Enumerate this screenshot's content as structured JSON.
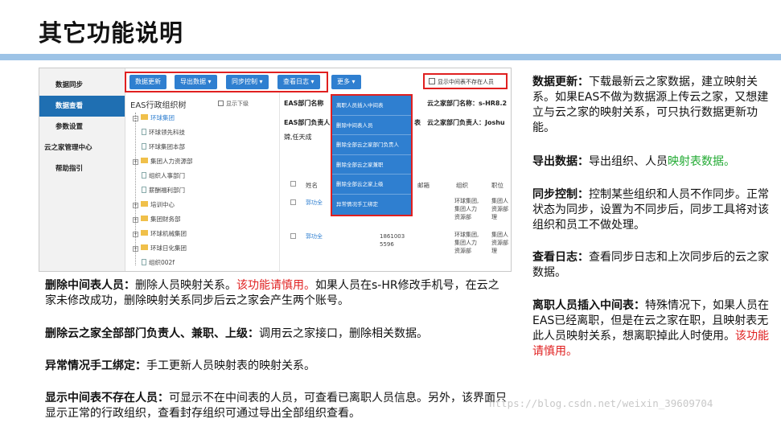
{
  "title": "其它功能说明",
  "screenshot": {
    "sidebar": [
      "数据同步",
      "数据查看",
      "参数设置",
      "云之家管理中心",
      "帮助指引"
    ],
    "toolbar": [
      "数据更新",
      "导出数据 ▾",
      "同步控制 ▾",
      "查看日志 ▾",
      "更多 ▾"
    ],
    "show_missing_checkbox": "显示中间表不存在人员",
    "dropdown": [
      "离职人员插入中间表",
      "删除中间表人员",
      "删除全部云之家部门负责人",
      "删除全部云之家兼职",
      "删除全部云之家上级",
      "异常情况手工绑定"
    ],
    "tree_title": "EAS行政组织树",
    "tree_show_children": "显示下级",
    "tree_nodes": [
      {
        "label": "环球集团",
        "kind": "folder",
        "toggle": "⊟"
      },
      {
        "label": "环球领先科技",
        "kind": "page",
        "toggle": ""
      },
      {
        "label": "环球集团本部",
        "kind": "page",
        "toggle": ""
      },
      {
        "label": "集团人力资源部",
        "kind": "folder",
        "toggle": "⊞"
      },
      {
        "label": "组织人事部门",
        "kind": "page",
        "toggle": ""
      },
      {
        "label": "薪酬福利部门",
        "kind": "page",
        "toggle": ""
      },
      {
        "label": "培训中心",
        "kind": "folder",
        "toggle": "⊞"
      },
      {
        "label": "集团财务部",
        "kind": "folder",
        "toggle": "⊞"
      },
      {
        "label": "环球机械集团",
        "kind": "folder",
        "toggle": "⊞"
      },
      {
        "label": "环球日化集团",
        "kind": "folder",
        "toggle": "⊞"
      },
      {
        "label": "组织002f",
        "kind": "page",
        "toggle": ""
      }
    ],
    "info": {
      "eas_dept_name": "EAS部门名称",
      "yzj_dept_name": "云之家部门名称：s-HR8.2",
      "eas_dept_head": "EAS部门负责人",
      "eas_dept_head_suffix": "表",
      "yzj_dept_head": "云之家部门负责人：Joshu",
      "people_line": "嫦,任天成"
    },
    "table_headers": [
      "姓名",
      "邮箱",
      "组织",
      "职位"
    ],
    "rows": [
      {
        "name": "郭功全",
        "phone": "",
        "org": "环球集团,\n集团人力\n资源部",
        "pos": "集团人\n资源部\n理"
      },
      {
        "name": "郭功全",
        "phone": "1861003\n5596",
        "org": "环球集团,\n集团人力\n资源部",
        "pos": "集团人\n资源部\n理"
      }
    ]
  },
  "notes_left": [
    {
      "label": "删除中间表人员：",
      "segments": [
        {
          "text": "删除人员映射关系。",
          "color": ""
        },
        {
          "text": "该功能请慎用。",
          "color": "red"
        },
        {
          "text": "如果人员在s-HR修改手机号，在云之家未修改成功，删除映射关系同步后云之家会产生两个账号。",
          "color": ""
        }
      ]
    },
    {
      "label": "删除云之家全部部门负责人、兼职、上级：",
      "segments": [
        {
          "text": "调用云之家接口，删除相关数据。",
          "color": ""
        }
      ]
    },
    {
      "label": "异常情况手工绑定：",
      "segments": [
        {
          "text": "手工更新人员映射表的映射关系。",
          "color": ""
        }
      ]
    },
    {
      "label": "显示中间表不存在人员：",
      "segments": [
        {
          "text": "可显示不在中间表的人员，可查看已离职人员信息。另外，该界面只显示正常的行政组织，查看封存组织可通过导出全部组织查看。",
          "color": ""
        }
      ]
    }
  ],
  "notes_right": [
    {
      "label": "数据更新：",
      "segments": [
        {
          "text": "下载最新云之家数据，建立映射关系。如果EAS不做为数据源上传云之家，又想建立与云之家的映射关系，可只执行数据更新功能。",
          "color": ""
        }
      ]
    },
    {
      "label": "导出数据：",
      "segments": [
        {
          "text": "导出组织、人员",
          "color": ""
        },
        {
          "text": "映射表数据。",
          "color": "green"
        }
      ]
    },
    {
      "label": "同步控制：",
      "segments": [
        {
          "text": "控制某些组织和人员不作同步。正常状态为同步，设置为不同步后，同步工具将对该组织和员工不做处理。",
          "color": ""
        }
      ]
    },
    {
      "label": "查看日志：",
      "segments": [
        {
          "text": "查看同步日志和上次同步后的云之家数据。",
          "color": ""
        }
      ]
    },
    {
      "label": "离职人员插入中间表：",
      "segments": [
        {
          "text": "特殊情况下，如果人员在EAS已经离职，但是在云之家在职，且映射表无此人员映射关系，想离职掉此人时使用。",
          "color": ""
        },
        {
          "text": "该功能请慎用。",
          "color": "red"
        }
      ]
    }
  ],
  "watermark": "https://blog.csdn.net/weixin_39609704",
  "colors": {
    "accent": "#2f7fd0",
    "highlight": "#e02020",
    "green": "#22aa33",
    "title_bar": "#9dc3e6"
  }
}
